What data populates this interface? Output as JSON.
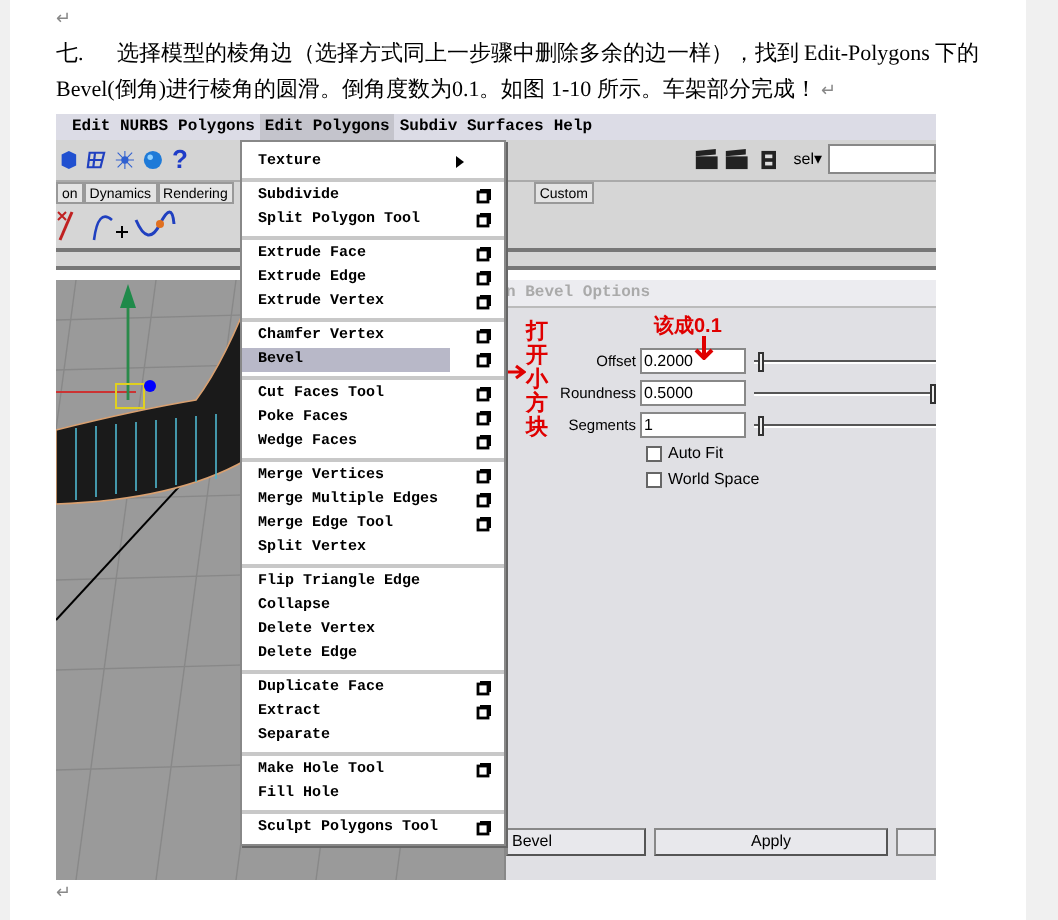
{
  "document": {
    "top_mark": "↵",
    "paragraph": {
      "text": "七.      选择模型的棱角边（选择方式同上一步骤中删除多余的边一样），找到 Edit-Polygons 下的 Bevel(倒角)进行棱角的圆滑。倒角度数为0.1。如图 1-10 所示。车架部分完成！",
      "mark": "↵"
    },
    "bottom_mark": "↵"
  },
  "screenshot": {
    "menubar": [
      {
        "label": "Edit NURBS",
        "selected": false
      },
      {
        "label": "Polygons",
        "selected": false
      },
      {
        "label": "Edit Polygons",
        "selected": true
      },
      {
        "label": "Subdiv Surfaces",
        "selected": false
      },
      {
        "label": "Help",
        "selected": false
      }
    ],
    "toolbar": {
      "help_glyph": "?",
      "sel_label": "sel▾"
    },
    "shelf_tabs": [
      "on",
      "Dynamics",
      "Rendering",
      "Custom"
    ],
    "menu": [
      [
        {
          "label": "Texture",
          "kind": "submenu",
          "selected": false
        }
      ],
      [
        {
          "label": "Subdivide",
          "kind": "option",
          "selected": false
        },
        {
          "label": "Split Polygon Tool",
          "kind": "option",
          "selected": false
        }
      ],
      [
        {
          "label": "Extrude Face",
          "kind": "option",
          "selected": false
        },
        {
          "label": "Extrude Edge",
          "kind": "option",
          "selected": false
        },
        {
          "label": "Extrude Vertex",
          "kind": "option",
          "selected": false
        }
      ],
      [
        {
          "label": "Chamfer Vertex",
          "kind": "option",
          "selected": false
        },
        {
          "label": "Bevel",
          "kind": "option",
          "selected": true
        }
      ],
      [
        {
          "label": "Cut Faces Tool",
          "kind": "option",
          "selected": false
        },
        {
          "label": "Poke Faces",
          "kind": "option",
          "selected": false
        },
        {
          "label": "Wedge Faces",
          "kind": "option",
          "selected": false
        }
      ],
      [
        {
          "label": "Merge Vertices",
          "kind": "option",
          "selected": false
        },
        {
          "label": "Merge Multiple Edges",
          "kind": "option",
          "selected": false
        },
        {
          "label": "Merge Edge Tool",
          "kind": "option",
          "selected": false
        },
        {
          "label": "Split Vertex",
          "kind": "plain",
          "selected": false
        }
      ],
      [
        {
          "label": "Flip Triangle Edge",
          "kind": "plain",
          "selected": false
        },
        {
          "label": "Collapse",
          "kind": "plain",
          "selected": false
        },
        {
          "label": "Delete Vertex",
          "kind": "plain",
          "selected": false
        },
        {
          "label": "Delete Edge",
          "kind": "plain",
          "selected": false
        }
      ],
      [
        {
          "label": "Duplicate Face",
          "kind": "option",
          "selected": false
        },
        {
          "label": "Extract",
          "kind": "option",
          "selected": false
        },
        {
          "label": "Separate",
          "kind": "plain",
          "selected": false
        }
      ],
      [
        {
          "label": "Make Hole Tool",
          "kind": "option",
          "selected": false
        },
        {
          "label": "Fill Hole",
          "kind": "plain",
          "selected": false
        }
      ],
      [
        {
          "label": "Sculpt Polygons Tool",
          "kind": "option",
          "selected": false
        }
      ]
    ],
    "dialog": {
      "title": "n Bevel Options",
      "fields": [
        {
          "label": "Offset",
          "value": "0.2000",
          "level": 0.02
        },
        {
          "label": "Roundness",
          "value": "0.5000",
          "level": 1
        },
        {
          "label": "Segments",
          "value": "1",
          "level": 0.02
        }
      ],
      "checkboxes": [
        {
          "label": "Auto Fit",
          "checked": false
        },
        {
          "label": "World Space",
          "checked": false
        }
      ],
      "buttons": [
        "Bevel",
        "Apply"
      ]
    },
    "annotations": {
      "open_box": "打开小方块",
      "change_to": "该成0.1"
    }
  }
}
